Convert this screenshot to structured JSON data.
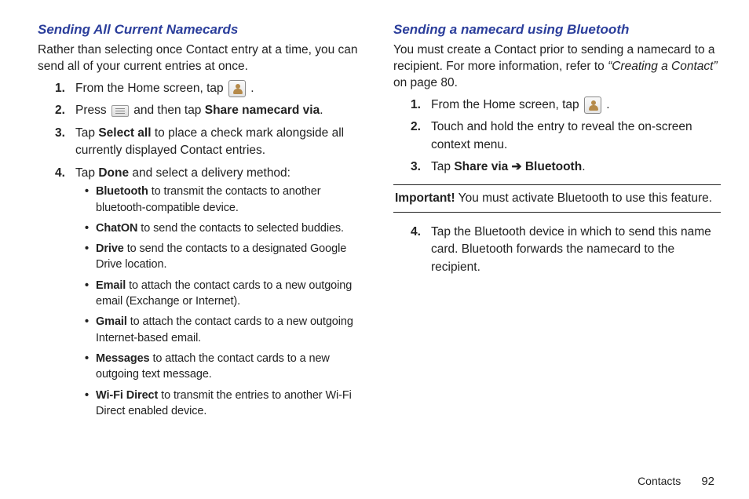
{
  "left": {
    "heading": "Sending All Current Namecards",
    "intro": "Rather than selecting once Contact entry at a time, you can send all of your current entries at once.",
    "step1_pre": "From the Home screen, tap ",
    "step1_post": " .",
    "step2_pre": "Press ",
    "step2_mid": " and then tap ",
    "step2_bold": "Share namecard via",
    "step2_post": ".",
    "step3_pre": "Tap ",
    "step3_bold": "Select all",
    "step3_post": " to place a check mark alongside all currently displayed Contact entries.",
    "step4_pre": "Tap ",
    "step4_bold": "Done",
    "step4_post": " and select a delivery method:",
    "bullets": {
      "bluetooth_b": "Bluetooth",
      "bluetooth_t": " to transmit the contacts to another bluetooth-compatible device.",
      "chaton_b": "ChatON",
      "chaton_t": " to send the contacts to selected buddies.",
      "drive_b": "Drive",
      "drive_t": " to send the contacts to a designated Google Drive location.",
      "email_b": "Email",
      "email_t": " to attach the contact cards to a new outgoing email (Exchange or Internet).",
      "gmail_b": "Gmail",
      "gmail_t": " to attach the contact cards to a new outgoing Internet-based email.",
      "messages_b": "Messages",
      "messages_t": " to attach the contact cards to a new outgoing text message.",
      "wifi_b": "Wi-Fi Direct",
      "wifi_t": " to transmit the entries to another Wi-Fi Direct enabled device."
    }
  },
  "right": {
    "heading": "Sending a namecard using Bluetooth",
    "intro_pre": "You must create a Contact prior to sending a namecard to a recipient. For more information, refer to ",
    "intro_ref": "“Creating a Contact”",
    "intro_post": " on page 80.",
    "step1_pre": "From the Home screen, tap ",
    "step1_post": " .",
    "step2": "Touch and hold the entry to reveal the on-screen context menu.",
    "step3_pre": "Tap ",
    "step3_b1": "Share via",
    "step3_arrow": " ➔ ",
    "step3_b2": "Bluetooth",
    "step3_post": ".",
    "important_b": "Important!",
    "important_t": " You must activate Bluetooth to use this feature.",
    "step4": "Tap the Bluetooth device in which to send this name card. Bluetooth forwards the namecard to the recipient."
  },
  "footer": {
    "section": "Contacts",
    "page": "92"
  },
  "nums": {
    "n1": "1.",
    "n2": "2.",
    "n3": "3.",
    "n4": "4."
  }
}
